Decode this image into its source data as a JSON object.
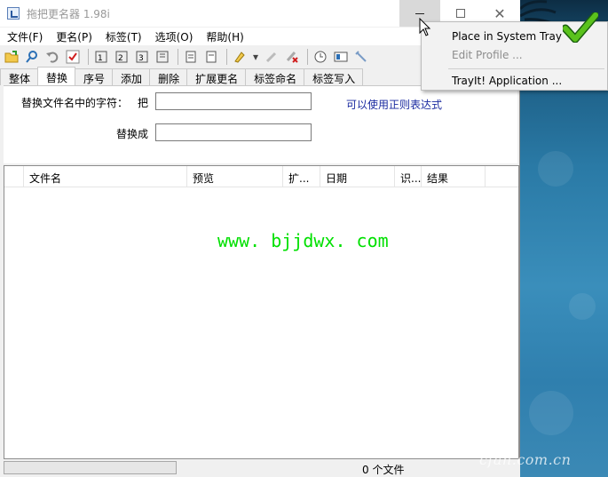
{
  "window": {
    "title": "拖把更名器 1.98i",
    "controls": {
      "minimize": "minimize",
      "maximize": "maximize",
      "close": "close"
    }
  },
  "menu": [
    "文件(F)",
    "更名(P)",
    "标签(T)",
    "选项(O)",
    "帮助(H)"
  ],
  "toolbar": {
    "icons": [
      "open-folder-icon",
      "search-icon",
      "undo-icon",
      "check-icon",
      "rename-icon-1",
      "rename-icon-2",
      "rename-icon-3",
      "rename-icon-4",
      "list-icon-1",
      "list-icon-2",
      "highlighter-icon",
      "dropdown-arrow-icon",
      "edit-icon",
      "delete-icon",
      "clock-icon",
      "window-icon",
      "tools-icon"
    ]
  },
  "tabs": [
    "整体",
    "替换",
    "序号",
    "添加",
    "删除",
    "扩展更名",
    "标签命名",
    "标签写入"
  ],
  "active_tab": "替换",
  "replace_panel": {
    "find_label": "替换文件名中的字符：",
    "find_value": "把",
    "replace_label": "替换成",
    "replace_value": "",
    "regex_link": "可以使用正则表达式"
  },
  "file_list": {
    "columns": [
      "文件名",
      "预览",
      "扩...",
      "日期",
      "识...",
      "结果"
    ],
    "rows": []
  },
  "overlay_text": "www. bjjdwx. com",
  "status": {
    "file_count": "0 个文件",
    "progress": 0
  },
  "context_menu": {
    "items": [
      {
        "label": "Place in System Tray",
        "enabled": true
      },
      {
        "label": "Edit Profile ...",
        "enabled": false
      },
      {
        "label": "TrayIt! Application ...",
        "enabled": true
      }
    ]
  },
  "watermark": "cfan.com.cn",
  "colors": {
    "link": "#1a2aa0",
    "overlay": "#00e000",
    "check": "#5ac21c"
  }
}
